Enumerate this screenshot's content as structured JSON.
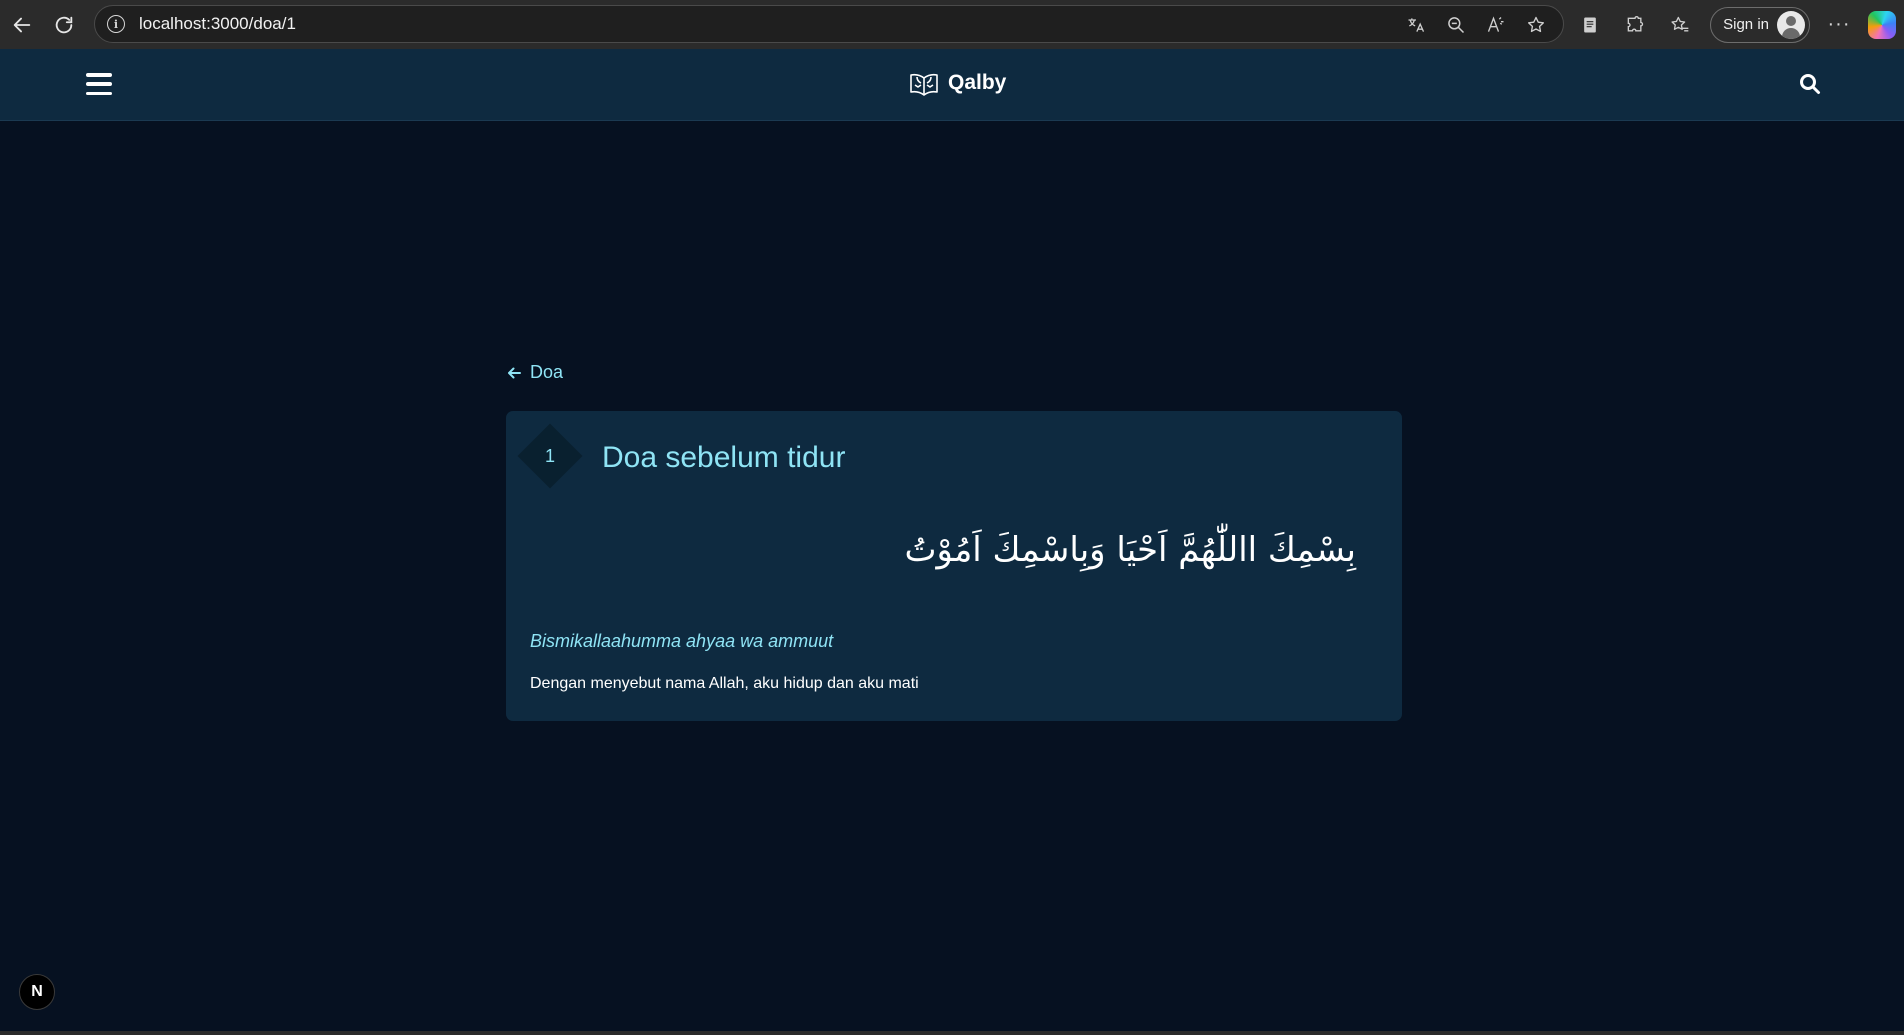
{
  "browser": {
    "url": "localhost:3000/doa/1",
    "signin_label": "Sign in",
    "more_label": "···"
  },
  "header": {
    "brand_name": "Qalby"
  },
  "content": {
    "back_label": "Doa",
    "doa": {
      "number": "1",
      "title": "Doa sebelum tidur",
      "arabic": "بِسْمِكَ االلّٰهُمَّ اَحْيَا وَبِاسْمِكَ اَمُوْتُ",
      "latin": "Bismikallaahumma ahyaa wa ammuut",
      "translation": "Dengan menyebut nama Allah, aku hidup dan aku mati"
    }
  },
  "dev_badge": {
    "label": "N"
  },
  "colors": {
    "page_bg": "#061121",
    "header_bg": "#0e2a40",
    "card_bg": "#0e2a40",
    "accent": "#8fe4f5"
  }
}
